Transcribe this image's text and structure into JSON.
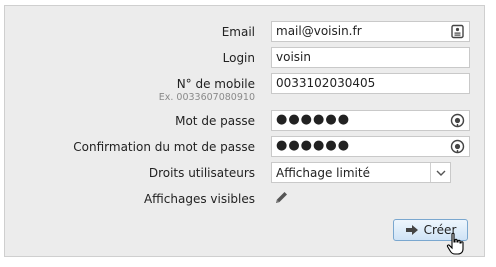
{
  "form": {
    "email": {
      "label": "Email",
      "value": "mail@voisin.fr"
    },
    "login": {
      "label": "Login",
      "value": "voisin"
    },
    "mobile": {
      "label": "N° de mobile",
      "hint": "Ex. 0033607080910",
      "value": "0033102030405"
    },
    "password": {
      "label": "Mot de passe",
      "value": "●●●●●●"
    },
    "password_confirm": {
      "label": "Confirmation du mot de passe",
      "value": "●●●●●●"
    },
    "rights": {
      "label": "Droits utilisateurs",
      "selected": "Affichage limité"
    },
    "displays": {
      "label": "Affichages visibles"
    },
    "submit_label": "Créer"
  }
}
